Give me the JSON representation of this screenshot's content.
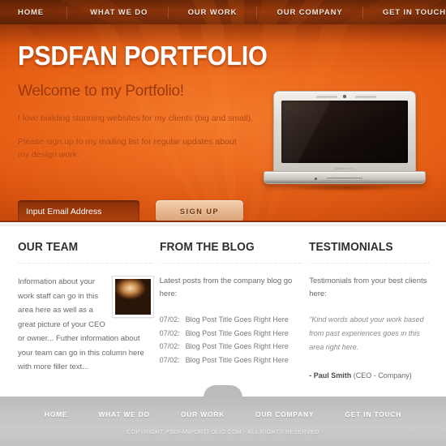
{
  "nav": {
    "items": [
      {
        "label": "HOME"
      },
      {
        "label": "WHAT WE DO"
      },
      {
        "label": "OUR WORK"
      },
      {
        "label": "OUR COMPANY"
      },
      {
        "label": "GET IN TOUCH"
      }
    ]
  },
  "hero": {
    "logo": "PSDFAN PORTFOLIO",
    "welcome": "Welcome to my Portfolio!",
    "paragraph_1": "I love building stunning websites for my clients (big and small).",
    "paragraph_2": "Please sign up to my mailing list for regular updates about my design work:",
    "email_placeholder": "Input Email Address",
    "email_value": "",
    "signup_label": "SIGN UP",
    "laptop_label": "MacBook Pro"
  },
  "columns": {
    "team": {
      "heading": "OUR TEAM",
      "body_1": "Information about your work staff can go in this area here as well as a great picture of your CEO or owner...",
      "body_2": "Futher information about your team can go in this column here with more filler text..."
    },
    "blog": {
      "heading": "FROM THE BLOG",
      "intro": "Latest posts from the company blog go here:",
      "posts": [
        {
          "date": "07/02:",
          "title": "Blog Post Title Goes Right Here"
        },
        {
          "date": "07/02:",
          "title": "Blog Post Title Goes Right Here"
        },
        {
          "date": "07/02:",
          "title": "Blog Post Title Goes Right Here"
        },
        {
          "date": "07/02:",
          "title": "Blog Post Title Goes Right Here"
        }
      ]
    },
    "testimonials": {
      "heading": "TESTIMONIALS",
      "intro": "Testimonials from your best clients here:",
      "quote": "\"Kind words about your  work based from past experiences goes in this area right here.",
      "author_name": "- Paul Smith",
      "author_role": " (CEO - Company)"
    }
  },
  "footer": {
    "items": [
      {
        "label": "HOME"
      },
      {
        "label": "WHAT WE DO"
      },
      {
        "label": "OUR WORK"
      },
      {
        "label": "OUR COMPANY"
      },
      {
        "label": "GET IN TOUCH"
      }
    ],
    "copyright": "COPYRIGHT PSDFANPORTFOLIO.COM - ALL RIGHTS RESERVED"
  },
  "colors": {
    "orange": "#e9600f",
    "nav_dark": "#8c3208",
    "footer_gray": "#c4c4c4",
    "input_dark": "#9c380a",
    "button_tan": "#e6b890"
  }
}
